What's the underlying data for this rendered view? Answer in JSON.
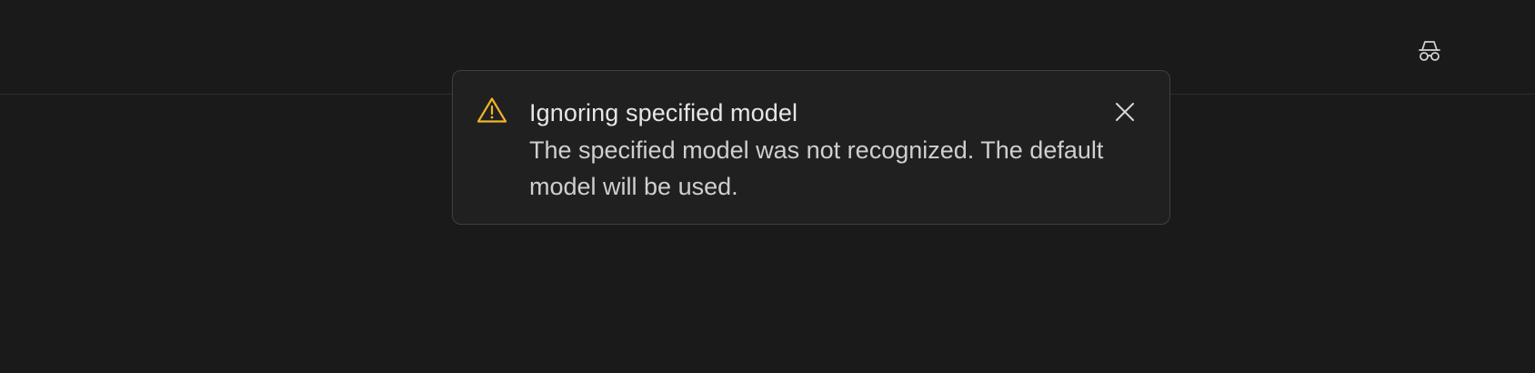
{
  "header": {
    "icons": {
      "incognito": "incognito-icon"
    }
  },
  "toast": {
    "type": "warning",
    "icon": "warning-icon",
    "title": "Ignoring specified model",
    "message": "The specified model was not recognized. The default model will be used.",
    "close_icon": "close-icon",
    "accent_color": "#f0b429"
  },
  "colors": {
    "background": "#1a1a1a",
    "toast_background": "#202020",
    "toast_border": "#3f3f3f",
    "text": "#e6e6e6",
    "warning": "#f0b429"
  }
}
